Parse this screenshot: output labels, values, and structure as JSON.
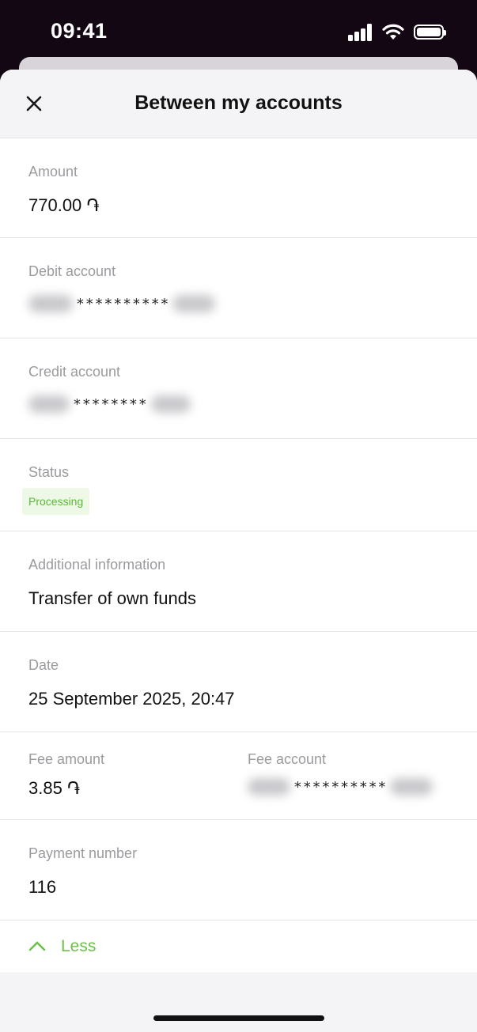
{
  "status_bar": {
    "time": "09:41"
  },
  "header": {
    "title": "Between my accounts"
  },
  "details": {
    "amount_label": "Amount",
    "amount_value": "770.00 ֏",
    "debit_label": "Debit account",
    "debit_masked": "**********",
    "credit_label": "Credit account",
    "credit_masked": "********",
    "status_label": "Status",
    "status_value": "Processing",
    "additional_label": "Additional information",
    "additional_value": "Transfer of own funds",
    "date_label": "Date",
    "date_value": "25 September 2025, 20:47",
    "fee_amount_label": "Fee amount",
    "fee_amount_value": "3.85 ֏",
    "fee_account_label": "Fee account",
    "fee_account_masked": "**********",
    "payment_number_label": "Payment number",
    "payment_number_value": "116"
  },
  "toggle": {
    "label": "Less"
  },
  "colors": {
    "accent": "#6cc04a",
    "status_bg": "#edf9e6",
    "label": "#9b9b9f",
    "background_dark": "#120712"
  }
}
